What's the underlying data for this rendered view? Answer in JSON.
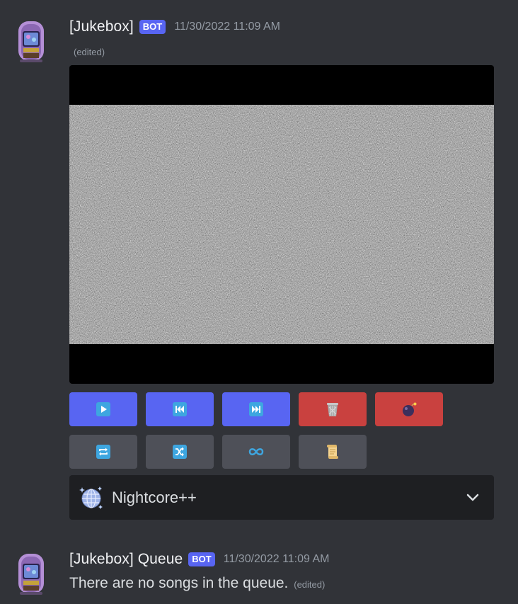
{
  "messages": [
    {
      "username": "[Jukebox]",
      "bot_tag": "BOT",
      "timestamp": "11/30/2022 11:09 AM",
      "edited": "(edited)",
      "avatar_icon": "jukebox-icon",
      "buttons_row1": [
        {
          "icon": "play-icon",
          "style": "blurple"
        },
        {
          "icon": "previous-track-icon",
          "style": "blurple"
        },
        {
          "icon": "next-track-icon",
          "style": "blurple"
        },
        {
          "icon": "wastebasket-icon",
          "style": "red"
        },
        {
          "icon": "bomb-icon",
          "style": "red"
        }
      ],
      "buttons_row2": [
        {
          "icon": "repeat-icon",
          "style": "grey"
        },
        {
          "icon": "shuffle-icon",
          "style": "grey"
        },
        {
          "icon": "infinity-icon",
          "style": "grey"
        },
        {
          "icon": "scroll-icon",
          "style": "grey"
        }
      ],
      "select": {
        "icon": "globe-icon",
        "selected": "Nightcore++"
      }
    },
    {
      "username": "[Jukebox] Queue",
      "bot_tag": "BOT",
      "timestamp": "11/30/2022 11:09 AM",
      "avatar_icon": "jukebox-icon",
      "text": "There are no songs in the queue.",
      "edited": "(edited)"
    }
  ],
  "colors": {
    "background": "#313338",
    "blurple": "#5865f2",
    "red": "#c9413f",
    "grey": "#4e5058",
    "select_bg": "#1e1f22",
    "muted": "#949ba4"
  }
}
